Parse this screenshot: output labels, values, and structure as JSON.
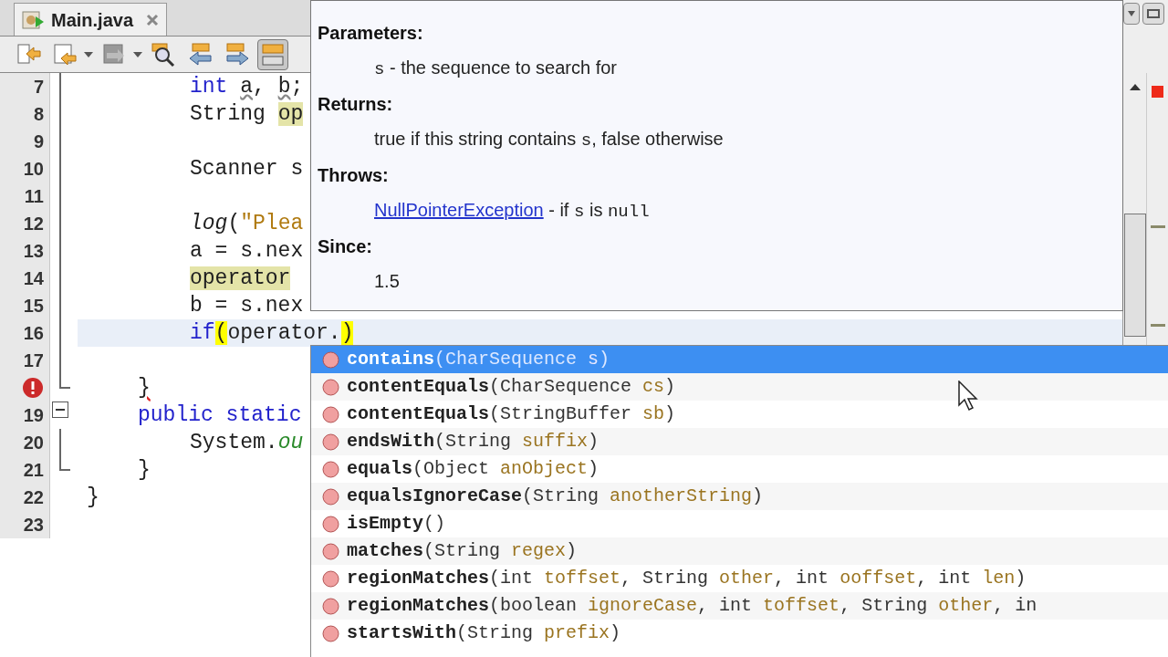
{
  "editor_tab": {
    "label": "Main.java",
    "selected": true
  },
  "toolbar": {
    "buttons": [
      {
        "kind": "back-source",
        "dropdown": false,
        "pressed": false
      },
      {
        "kind": "back-edit",
        "dropdown": true,
        "pressed": false
      },
      {
        "kind": "forward-edit",
        "dropdown": true,
        "pressed": false
      },
      {
        "kind": "find",
        "dropdown": false,
        "pressed": false
      },
      {
        "kind": "prev",
        "dropdown": false,
        "pressed": false
      },
      {
        "kind": "next",
        "dropdown": false,
        "pressed": false
      },
      {
        "kind": "toggle",
        "dropdown": false,
        "pressed": true
      }
    ]
  },
  "code_lines": [
    {
      "number": "7",
      "kind": "guide",
      "in_class": true,
      "in_method": true,
      "current": false,
      "tokens": [
        {
          "text": "int ",
          "kind": "keyword"
        },
        {
          "text": "a",
          "kind": "warning"
        },
        {
          "text": ", ",
          "kind": "plain"
        },
        {
          "text": "b",
          "kind": "warning"
        },
        {
          "text": ";",
          "kind": "plain"
        }
      ]
    },
    {
      "number": "8",
      "kind": "guide",
      "in_class": true,
      "in_method": true,
      "current": false,
      "tokens": [
        {
          "text": "String ",
          "kind": "plain"
        },
        {
          "text": "op",
          "kind": "occurrence"
        }
      ]
    },
    {
      "number": "9",
      "kind": "guide",
      "current": false
    },
    {
      "number": "10",
      "kind": "guide",
      "in_class": true,
      "in_method": true,
      "current": false,
      "tokens": [
        {
          "text": "Scanner s",
          "kind": "plain"
        }
      ]
    },
    {
      "number": "11",
      "kind": "guide",
      "current": false
    },
    {
      "number": "12",
      "kind": "guide",
      "in_class": true,
      "in_method": true,
      "current": false,
      "tokens": [
        {
          "text": "log",
          "kind": "method"
        },
        {
          "text": "(",
          "kind": "plain"
        },
        {
          "text": "\"Plea",
          "kind": "string"
        }
      ]
    },
    {
      "number": "13",
      "kind": "guide",
      "in_class": true,
      "in_method": true,
      "current": false,
      "tokens": [
        {
          "text": "a = s.nex",
          "kind": "plain"
        }
      ]
    },
    {
      "number": "14",
      "kind": "guide",
      "in_class": true,
      "in_method": true,
      "current": false,
      "tokens": [
        {
          "text": "operator",
          "kind": "occurrence"
        }
      ]
    },
    {
      "number": "15",
      "kind": "guide",
      "in_class": true,
      "in_method": true,
      "current": false,
      "tokens": [
        {
          "text": "b = s.nex",
          "kind": "plain"
        }
      ]
    },
    {
      "number": "16",
      "kind": "guide",
      "in_class": true,
      "in_method": true,
      "current": true,
      "tokens": [
        {
          "text": "if",
          "kind": "keyword"
        },
        {
          "text": "(",
          "kind": "bracket-match"
        },
        {
          "text": "operator.",
          "kind": "plain"
        },
        {
          "text": ")",
          "kind": "bracket-match"
        }
      ]
    },
    {
      "number": "17",
      "kind": "guide",
      "current": false
    },
    {
      "error": true,
      "kind": "guide-end",
      "in_class": true,
      "in_method": false,
      "current": false,
      "tokens": [
        {
          "text": "}",
          "kind": "error"
        }
      ]
    },
    {
      "number": "19",
      "kind": "fold-start",
      "in_class": true,
      "in_method": false,
      "current": false,
      "tokens": [
        {
          "text": "public static",
          "kind": "keyword"
        }
      ]
    },
    {
      "number": "20",
      "kind": "guide",
      "in_class": true,
      "in_method": true,
      "current": false,
      "tokens": [
        {
          "text": "System.",
          "kind": "plain"
        },
        {
          "text": "ou",
          "kind": "static-field"
        }
      ]
    },
    {
      "number": "21",
      "kind": "guide-end",
      "in_class": true,
      "in_method": false,
      "current": false,
      "tokens": [
        {
          "text": "}",
          "kind": "plain"
        }
      ]
    },
    {
      "number": "22",
      "kind": "plain",
      "in_class": false,
      "in_method": false,
      "current": false,
      "tokens": [
        {
          "text": "}",
          "kind": "plain"
        }
      ]
    },
    {
      "number": "23",
      "kind": "plain",
      "current": false
    }
  ],
  "javadoc": {
    "sections": [
      {
        "heading": "Parameters:",
        "parts": [
          {
            "text": "s",
            "kind": "code"
          },
          {
            "text": " - the sequence to search for",
            "kind": "text"
          }
        ]
      },
      {
        "heading": "Returns:",
        "parts": [
          {
            "text": "true if this string contains ",
            "kind": "text"
          },
          {
            "text": "s",
            "kind": "code"
          },
          {
            "text": ", false otherwise",
            "kind": "text"
          }
        ]
      },
      {
        "heading": "Throws:",
        "parts": [
          {
            "text": "NullPointerException",
            "kind": "link"
          },
          {
            "text": " - if ",
            "kind": "text"
          },
          {
            "text": "s",
            "kind": "code"
          },
          {
            "text": " is ",
            "kind": "text"
          },
          {
            "text": "null",
            "kind": "code"
          }
        ]
      },
      {
        "heading": "Since:",
        "parts": [
          {
            "text": "1.5",
            "kind": "text"
          }
        ]
      }
    ]
  },
  "completions": [
    {
      "name": "contains",
      "selected": true,
      "signature": [
        {
          "text": "(CharSequence ",
          "kind": "type"
        },
        {
          "text": "s",
          "kind": "param"
        },
        {
          "text": ")",
          "kind": "type"
        }
      ]
    },
    {
      "name": "contentEquals",
      "selected": false,
      "signature": [
        {
          "text": "(CharSequence ",
          "kind": "type"
        },
        {
          "text": "cs",
          "kind": "param"
        },
        {
          "text": ")",
          "kind": "type"
        }
      ]
    },
    {
      "name": "contentEquals",
      "selected": false,
      "signature": [
        {
          "text": "(StringBuffer ",
          "kind": "type"
        },
        {
          "text": "sb",
          "kind": "param"
        },
        {
          "text": ")",
          "kind": "type"
        }
      ]
    },
    {
      "name": "endsWith",
      "selected": false,
      "signature": [
        {
          "text": "(String ",
          "kind": "type"
        },
        {
          "text": "suffix",
          "kind": "param"
        },
        {
          "text": ")",
          "kind": "type"
        }
      ]
    },
    {
      "name": "equals",
      "selected": false,
      "signature": [
        {
          "text": "(Object ",
          "kind": "type"
        },
        {
          "text": "anObject",
          "kind": "param"
        },
        {
          "text": ")",
          "kind": "type"
        }
      ]
    },
    {
      "name": "equalsIgnoreCase",
      "selected": false,
      "signature": [
        {
          "text": "(String ",
          "kind": "type"
        },
        {
          "text": "anotherString",
          "kind": "param"
        },
        {
          "text": ")",
          "kind": "type"
        }
      ]
    },
    {
      "name": "isEmpty",
      "selected": false,
      "signature": [
        {
          "text": "()",
          "kind": "type"
        }
      ]
    },
    {
      "name": "matches",
      "selected": false,
      "signature": [
        {
          "text": "(String ",
          "kind": "type"
        },
        {
          "text": "regex",
          "kind": "param"
        },
        {
          "text": ")",
          "kind": "type"
        }
      ]
    },
    {
      "name": "regionMatches",
      "selected": false,
      "signature": [
        {
          "text": "(int ",
          "kind": "type"
        },
        {
          "text": "toffset",
          "kind": "param"
        },
        {
          "text": ", String ",
          "kind": "type"
        },
        {
          "text": "other",
          "kind": "param"
        },
        {
          "text": ", int ",
          "kind": "type"
        },
        {
          "text": "ooffset",
          "kind": "param"
        },
        {
          "text": ", int ",
          "kind": "type"
        },
        {
          "text": "len",
          "kind": "param"
        },
        {
          "text": ")",
          "kind": "type"
        }
      ]
    },
    {
      "name": "regionMatches",
      "selected": false,
      "signature": [
        {
          "text": "(boolean ",
          "kind": "type"
        },
        {
          "text": "ignoreCase",
          "kind": "param"
        },
        {
          "text": ", int ",
          "kind": "type"
        },
        {
          "text": "toffset",
          "kind": "param"
        },
        {
          "text": ", String ",
          "kind": "type"
        },
        {
          "text": "other",
          "kind": "param"
        },
        {
          "text": ", in",
          "kind": "type"
        }
      ]
    },
    {
      "name": "startsWith",
      "selected": false,
      "signature": [
        {
          "text": "(String ",
          "kind": "type"
        },
        {
          "text": "prefix",
          "kind": "param"
        },
        {
          "text": ")",
          "kind": "type"
        }
      ]
    }
  ]
}
